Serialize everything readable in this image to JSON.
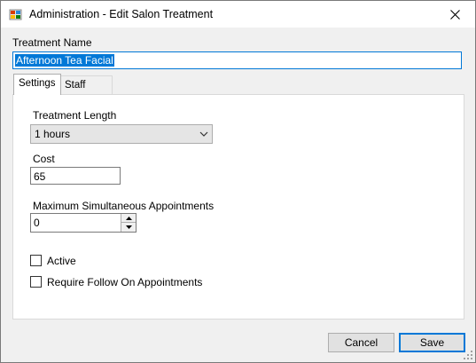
{
  "window": {
    "title": "Administration - Edit Salon Treatment"
  },
  "form": {
    "treatment_name_label": "Treatment Name",
    "treatment_name_value": "Afternoon Tea Facial",
    "tabs": [
      {
        "label": "Settings",
        "active": true
      },
      {
        "label": "Staff Members",
        "active": false
      }
    ],
    "settings": {
      "treatment_length_label": "Treatment Length",
      "treatment_length_value": "1 hours",
      "cost_label": "Cost",
      "cost_value": "65",
      "max_appointments_label": "Maximum Simultaneous Appointments",
      "max_appointments_value": "0",
      "active_label": "Active",
      "active_checked": false,
      "follow_on_label": "Require Follow On Appointments",
      "follow_on_checked": false
    }
  },
  "buttons": {
    "cancel": "Cancel",
    "save": "Save"
  },
  "icons": {
    "app": "app-icon",
    "close": "close-icon",
    "dropdown": "chevron-down-icon"
  },
  "colors": {
    "accent": "#0078d7",
    "dialog_bg": "#f0f0f0"
  }
}
